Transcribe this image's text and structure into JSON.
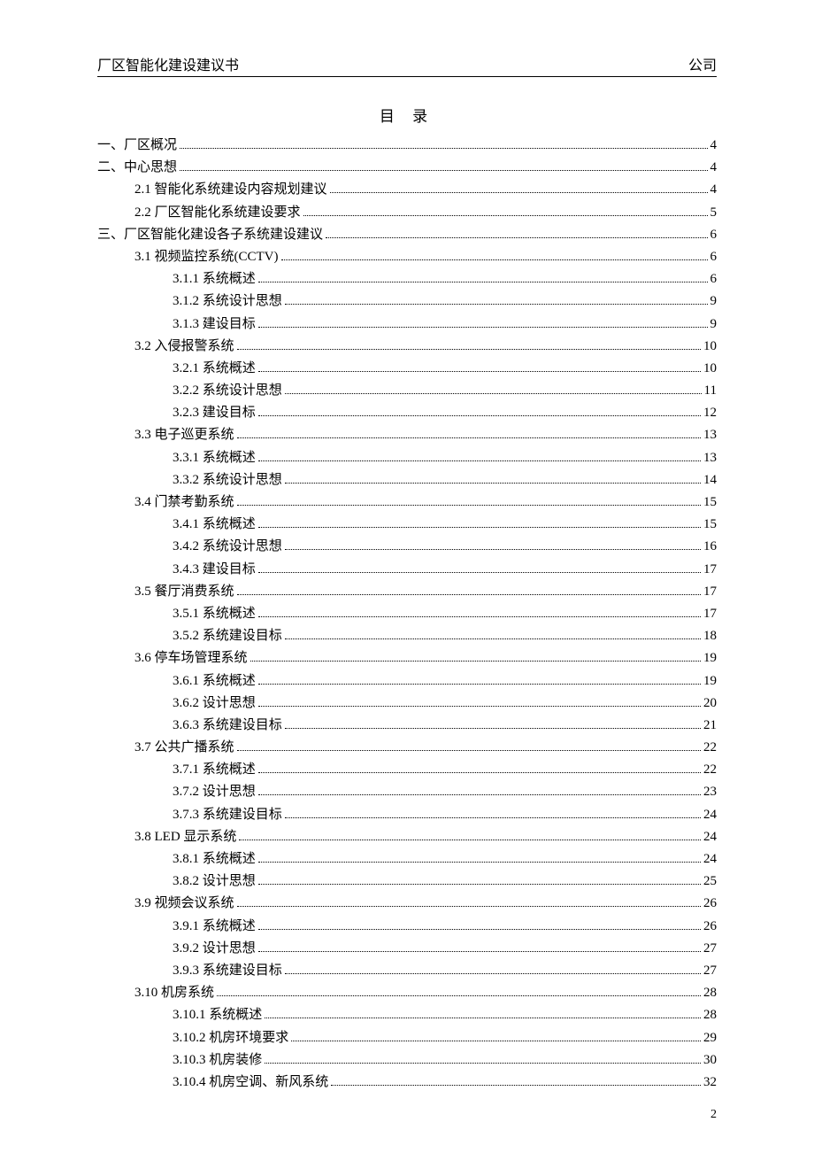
{
  "header": {
    "left": "厂区智能化建设建议书",
    "right": "公司"
  },
  "toc_title": "目  录",
  "page_number": "2",
  "toc": [
    {
      "lvl": 0,
      "label": "一、厂区概况",
      "page": "4"
    },
    {
      "lvl": 0,
      "label": "二、中心思想",
      "page": "4"
    },
    {
      "lvl": 1,
      "label": "2.1 智能化系统建设内容规划建议",
      "page": "4"
    },
    {
      "lvl": 1,
      "label": "2.2 厂区智能化系统建设要求",
      "page": "5"
    },
    {
      "lvl": 0,
      "label": "三、厂区智能化建设各子系统建设建议",
      "page": "6"
    },
    {
      "lvl": 1,
      "label": "3.1 视频监控系统(CCTV)",
      "page": "6"
    },
    {
      "lvl": 2,
      "label": "3.1.1 系统概述",
      "page": "6"
    },
    {
      "lvl": 2,
      "label": "3.1.2 系统设计思想",
      "page": "9"
    },
    {
      "lvl": 2,
      "label": "3.1.3  建设目标",
      "page": "9"
    },
    {
      "lvl": 1,
      "label": "3.2 入侵报警系统",
      "page": "10"
    },
    {
      "lvl": 2,
      "label": "3.2.1 系统概述",
      "page": "10"
    },
    {
      "lvl": 2,
      "label": "3.2.2 系统设计思想",
      "page": "11"
    },
    {
      "lvl": 2,
      "label": "3.2.3 建设目标",
      "page": "12"
    },
    {
      "lvl": 1,
      "label": "3.3 电子巡更系统",
      "page": "13"
    },
    {
      "lvl": 2,
      "label": "3.3.1 系统概述",
      "page": "13"
    },
    {
      "lvl": 2,
      "label": "3.3.2 系统设计思想",
      "page": "14"
    },
    {
      "lvl": 1,
      "label": "3.4 门禁考勤系统",
      "page": "15"
    },
    {
      "lvl": 2,
      "label": "3.4.1 系统概述",
      "page": "15"
    },
    {
      "lvl": 2,
      "label": "3.4.2 系统设计思想",
      "page": "16"
    },
    {
      "lvl": 2,
      "label": "3.4.3 建设目标",
      "page": "17"
    },
    {
      "lvl": 1,
      "label": "3.5 餐厅消费系统",
      "page": "17"
    },
    {
      "lvl": 2,
      "label": "3.5.1 系统概述",
      "page": "17"
    },
    {
      "lvl": 2,
      "label": "3.5.2 系统建设目标",
      "page": "18"
    },
    {
      "lvl": 1,
      "label": "3.6 停车场管理系统",
      "page": "19"
    },
    {
      "lvl": 2,
      "label": "3.6.1 系统概述",
      "page": "19"
    },
    {
      "lvl": 2,
      "label": "3.6.2 设计思想",
      "page": "20"
    },
    {
      "lvl": 2,
      "label": "3.6.3 系统建设目标",
      "page": "21"
    },
    {
      "lvl": 1,
      "label": "3.7 公共广播系统",
      "page": "22"
    },
    {
      "lvl": 2,
      "label": "3.7.1 系统概述",
      "page": "22"
    },
    {
      "lvl": 2,
      "label": "3.7.2 设计思想",
      "page": "23"
    },
    {
      "lvl": 2,
      "label": "3.7.3 系统建设目标",
      "page": "24"
    },
    {
      "lvl": 1,
      "label": "3.8 LED 显示系统",
      "page": "24"
    },
    {
      "lvl": 2,
      "label": "3.8.1 系统概述",
      "page": "24"
    },
    {
      "lvl": 2,
      "label": "3.8.2 设计思想",
      "page": "25"
    },
    {
      "lvl": 1,
      "label": "3.9 视频会议系统",
      "page": "26"
    },
    {
      "lvl": 2,
      "label": "3.9.1 系统概述",
      "page": "26"
    },
    {
      "lvl": 2,
      "label": "3.9.2 设计思想",
      "page": "27"
    },
    {
      "lvl": 2,
      "label": "3.9.3 系统建设目标",
      "page": "27"
    },
    {
      "lvl": 1,
      "label": "3.10 机房系统",
      "page": "28"
    },
    {
      "lvl": 2,
      "label": "3.10.1 系统概述",
      "page": "28"
    },
    {
      "lvl": 2,
      "label": "3.10.2 机房环境要求",
      "page": "29"
    },
    {
      "lvl": 2,
      "label": "3.10.3 机房装修",
      "page": "30"
    },
    {
      "lvl": 2,
      "label": "3.10.4 机房空调、新风系统",
      "page": "32"
    }
  ]
}
